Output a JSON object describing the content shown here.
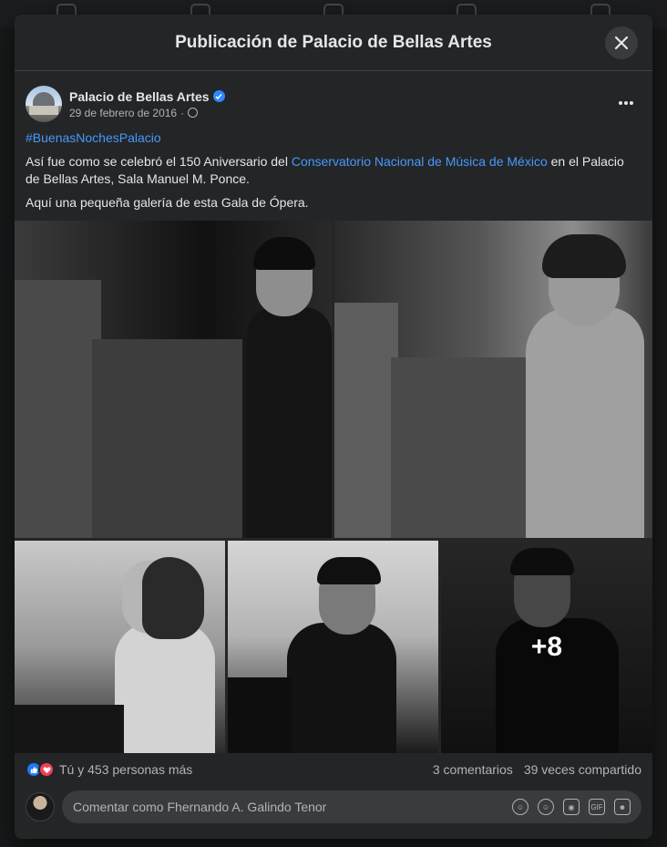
{
  "modal": {
    "title": "Publicación de Palacio de Bellas Artes"
  },
  "post": {
    "page_name": "Palacio de Bellas Artes",
    "date": "29 de febrero de 2016",
    "date_sep": "·",
    "hashtag": "#BuenasNochesPalacio",
    "text_line1_a": "Así fue como se celebró el 150 Aniversario del ",
    "text_line1_link": "Conservatorio Nacional de Música de México",
    "text_line1_b": " en el Palacio de Bellas Artes, Sala Manuel M. Ponce.",
    "text_line2": "Aquí una pequeña galería de esta Gala de Ópera.",
    "more_photos_label": "+8"
  },
  "reactions": {
    "summary": "Tú y 453 personas más",
    "comments": "3 comentarios",
    "shares": "39 veces compartido"
  },
  "comment": {
    "placeholder": "Comentar como Fhernando A. Galindo Tenor"
  },
  "icons": {
    "close": "close-icon",
    "verified": "verified-badge-icon",
    "globe": "globe-icon",
    "more": "more-options-icon",
    "like": "like-reaction-icon",
    "love": "love-reaction-icon",
    "avatar_frame": "avatar-icon",
    "emoji": "emoji-icon",
    "camera": "camera-icon",
    "gif": "gif-icon",
    "sticker": "sticker-icon",
    "avatar_sticker": "avatar-sticker-icon"
  },
  "colors": {
    "background": "#18191a",
    "modal": "#242526",
    "link": "#4599ff",
    "like_blue": "#2078f4",
    "love_red": "#f33e58",
    "verified_blue": "#2d88ff"
  }
}
